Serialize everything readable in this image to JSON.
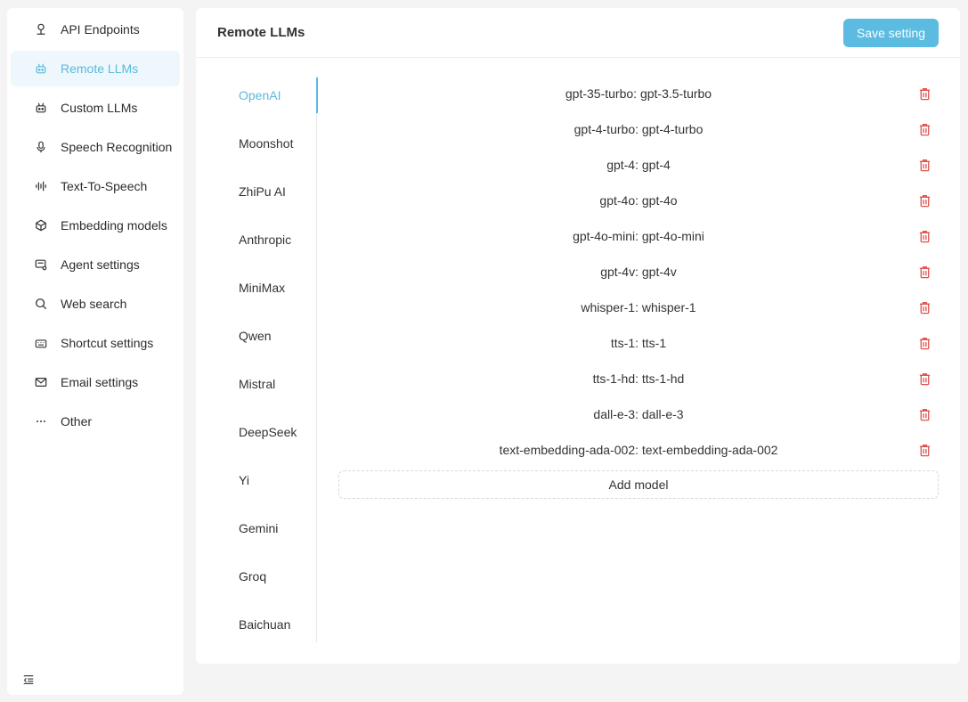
{
  "sidebar": {
    "items": [
      {
        "label": "API Endpoints",
        "icon": "api-endpoints-icon"
      },
      {
        "label": "Remote LLMs",
        "icon": "robot-icon",
        "active": true
      },
      {
        "label": "Custom LLMs",
        "icon": "robot-icon"
      },
      {
        "label": "Speech Recognition",
        "icon": "microphone-icon"
      },
      {
        "label": "Text-To-Speech",
        "icon": "sound-wave-icon"
      },
      {
        "label": "Embedding models",
        "icon": "embedding-icon"
      },
      {
        "label": "Agent settings",
        "icon": "agent-icon"
      },
      {
        "label": "Web search",
        "icon": "search-icon"
      },
      {
        "label": "Shortcut settings",
        "icon": "keyboard-icon"
      },
      {
        "label": "Email settings",
        "icon": "mail-icon"
      },
      {
        "label": "Other",
        "icon": "ellipsis-icon"
      }
    ],
    "collapse_icon": "menu-fold-icon"
  },
  "main": {
    "title": "Remote LLMs",
    "save_label": "Save setting"
  },
  "providers": [
    {
      "label": "OpenAI",
      "active": true
    },
    {
      "label": "Moonshot"
    },
    {
      "label": "ZhiPu AI"
    },
    {
      "label": "Anthropic"
    },
    {
      "label": "MiniMax"
    },
    {
      "label": "Qwen"
    },
    {
      "label": "Mistral"
    },
    {
      "label": "DeepSeek"
    },
    {
      "label": "Yi"
    },
    {
      "label": "Gemini"
    },
    {
      "label": "Groq"
    },
    {
      "label": "Baichuan"
    }
  ],
  "models": [
    "gpt-35-turbo: gpt-3.5-turbo",
    "gpt-4-turbo: gpt-4-turbo",
    "gpt-4: gpt-4",
    "gpt-4o: gpt-4o",
    "gpt-4o-mini: gpt-4o-mini",
    "gpt-4v: gpt-4v",
    "whisper-1: whisper-1",
    "tts-1: tts-1",
    "tts-1-hd: tts-1-hd",
    "dall-e-3: dall-e-3",
    "text-embedding-ada-002: text-embedding-ada-002"
  ],
  "add_model_label": "Add model",
  "colors": {
    "accent": "#5bbbe0",
    "active_bg": "#eef8fc",
    "danger": "#e0524e"
  }
}
